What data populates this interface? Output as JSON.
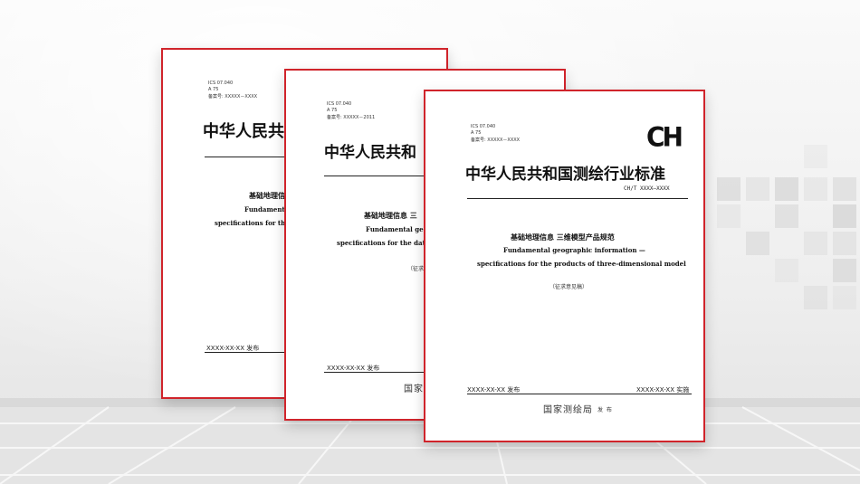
{
  "background": {
    "accent_color": "#d0242b",
    "deco_square_color": "#d7d7d7"
  },
  "doc_back": {
    "meta": [
      "ICS  07.040",
      "A  75",
      "备案号: XXXXX－XXXX"
    ],
    "title": "中华人民共",
    "subtitle_cn": "基础地理信",
    "subtitle_en_1": "Fundamenta",
    "subtitle_en_2": "specifications for the p",
    "date": "XXXX-XX-XX 发布"
  },
  "doc_middle": {
    "meta": [
      "ICS  07.040",
      "A  75",
      "备案号: XXXXX－2011"
    ],
    "title": "中华人民共和",
    "subtitle_cn": "基础地理信息  三",
    "subtitle_en_1": "Fundamental geograp",
    "subtitle_en_2": "specifications for the datab",
    "draft": "（征求",
    "date": "XXXX-XX-XX 发布",
    "issuer": "国家"
  },
  "doc_front": {
    "meta": [
      "ICS  07.040",
      "A  75",
      "备案号: XXXXX－XXXX"
    ],
    "logo": "CH",
    "title": "中华人民共和国测绘行业标准",
    "std_no": "CH/T XXXX—XXXX",
    "subtitle_cn": "基础地理信息  三维模型产品规范",
    "subtitle_en_1": "Fundamental geographic information —",
    "subtitle_en_2": "specifications for the products of three-dimensional model",
    "draft": "（征求意见稿）",
    "date_release": "XXXX-XX-XX 发布",
    "date_effective": "XXXX-XX-XX 实施",
    "issuer": "国家测绘局",
    "issuer_suffix": "发 布"
  }
}
